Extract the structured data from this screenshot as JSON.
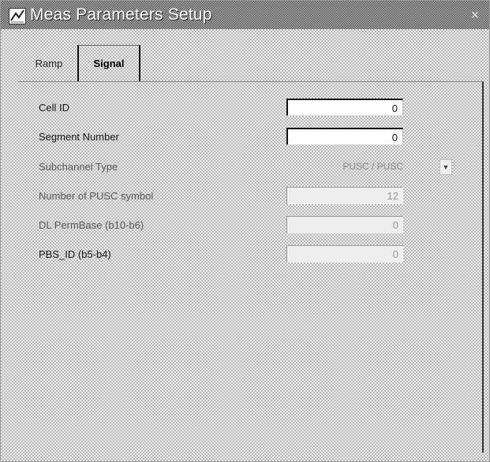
{
  "window": {
    "title": "Meas Parameters Setup",
    "close_glyph": "×",
    "icon": "app-logo-icon"
  },
  "tabs": [
    {
      "label": "Ramp",
      "selected": false
    },
    {
      "label": "Signal",
      "selected": true
    }
  ],
  "fields": {
    "cell_id": {
      "label": "Cell ID",
      "value": "0",
      "enabled": true
    },
    "segment_number": {
      "label": "Segment Number",
      "value": "0",
      "enabled": true
    },
    "subchannel_type": {
      "label": "Subchannel Type",
      "value": "PUSC / PUSC",
      "enabled": false
    },
    "pusc_symbols": {
      "label": "Number of PUSC symbol",
      "value": "12",
      "enabled": false
    },
    "dl_permbase": {
      "label": "DL PermBase (b10-b6)",
      "value": "0",
      "enabled": false
    },
    "pbs_id": {
      "label": "PBS_ID (b5-b4)",
      "value": "0",
      "enabled": false
    }
  }
}
